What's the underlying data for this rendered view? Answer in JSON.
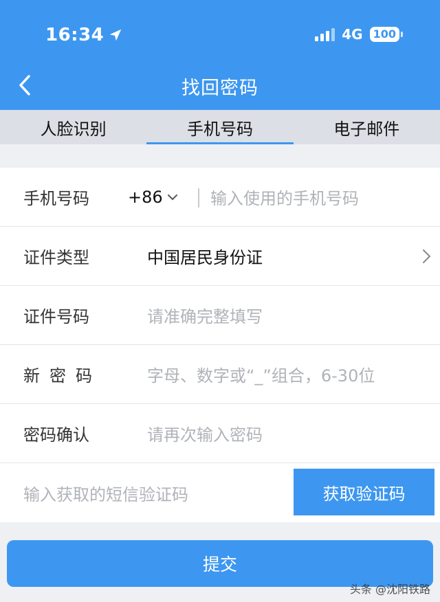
{
  "status_bar": {
    "time": "16:34",
    "network": "4G",
    "battery": "100"
  },
  "header": {
    "title": "找回密码"
  },
  "tabs": [
    {
      "label": "人脸识别",
      "active": false
    },
    {
      "label": "手机号码",
      "active": true
    },
    {
      "label": "电子邮件",
      "active": false
    }
  ],
  "form": {
    "phone": {
      "label": "手机号码",
      "country_code": "+86",
      "placeholder": "输入使用的手机号码"
    },
    "id_type": {
      "label": "证件类型",
      "value": "中国居民身份证"
    },
    "id_number": {
      "label": "证件号码",
      "placeholder": "请准确完整填写"
    },
    "new_password": {
      "label": "新密码",
      "placeholder": "字母、数字或“_”组合，6-30位"
    },
    "confirm_password": {
      "label": "密码确认",
      "placeholder": "请再次输入密码"
    },
    "sms": {
      "placeholder": "输入获取的短信验证码",
      "button": "获取验证码"
    }
  },
  "submit_label": "提交",
  "watermark": "头条 @沈阳铁路",
  "colors": {
    "accent": "#3d97f0",
    "tab_bar": "#dcdfe5",
    "background": "#eef0f4"
  }
}
